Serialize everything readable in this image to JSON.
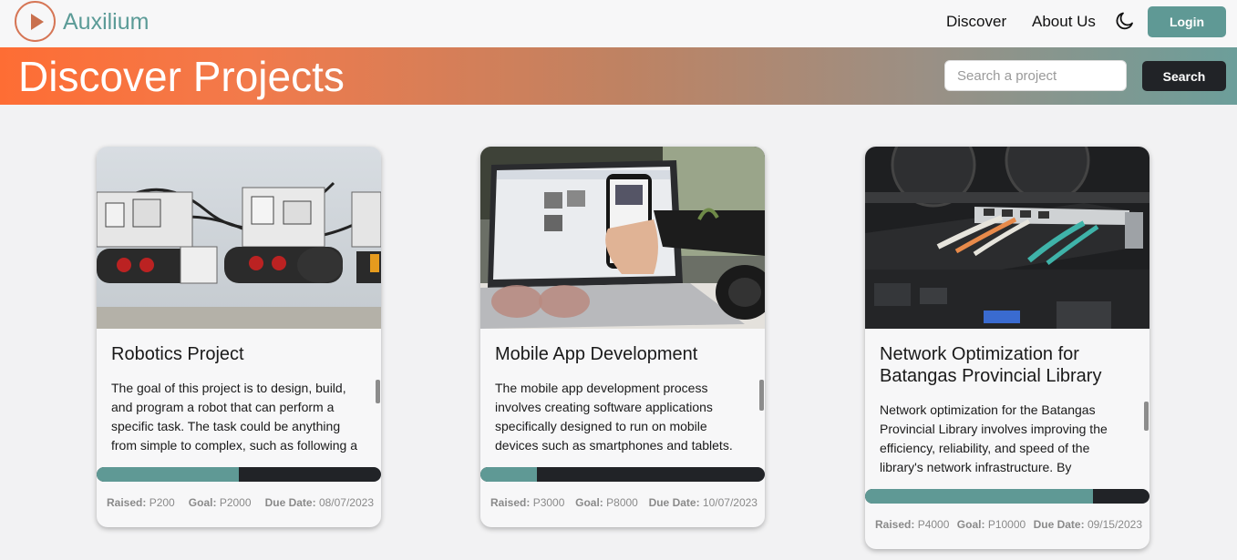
{
  "navbar": {
    "brand": "Auxilium",
    "links": [
      "Discover",
      "About Us"
    ],
    "login_label": "Login"
  },
  "hero": {
    "title": "Discover Projects",
    "search_placeholder": "Search a project",
    "search_label": "Search"
  },
  "projects": [
    {
      "title": "Robotics Project",
      "description": "The goal of this project is to design, build, and program a robot that can perform a specific task. The task could be anything from simple to complex, such as following a",
      "progress": 0.5,
      "raised_label": "Raised:",
      "raised": "P200",
      "goal_label": "Goal:",
      "goal": "P2000",
      "due_label": "Due Date:",
      "due": "08/07/2023",
      "image": "robotics-kits-photo"
    },
    {
      "title": "Mobile App Development",
      "description": "The mobile app development process involves creating software applications specifically designed to run on mobile devices such as smartphones and tablets.",
      "progress": 0.2,
      "raised_label": "Raised:",
      "raised": "P3000",
      "goal_label": "Goal:",
      "goal": "P8000",
      "due_label": "Due Date:",
      "due": "10/07/2023",
      "image": "laptop-phone-photo"
    },
    {
      "title": "Network Optimization for Batangas Provincial Library",
      "description": "Network optimization for the Batangas Provincial Library involves improving the efficiency, reliability, and speed of the library's network infrastructure. By",
      "progress": 0.8,
      "raised_label": "Raised:",
      "raised": "P4000",
      "goal_label": "Goal:",
      "goal": "P10000",
      "due_label": "Due Date:",
      "due": "09/15/2023",
      "image": "network-switch-photo"
    }
  ],
  "colors": {
    "accent": "#5f9995",
    "dark": "#212327",
    "hero_start": "#fe6d34",
    "hero_end": "#6c9e9a"
  }
}
